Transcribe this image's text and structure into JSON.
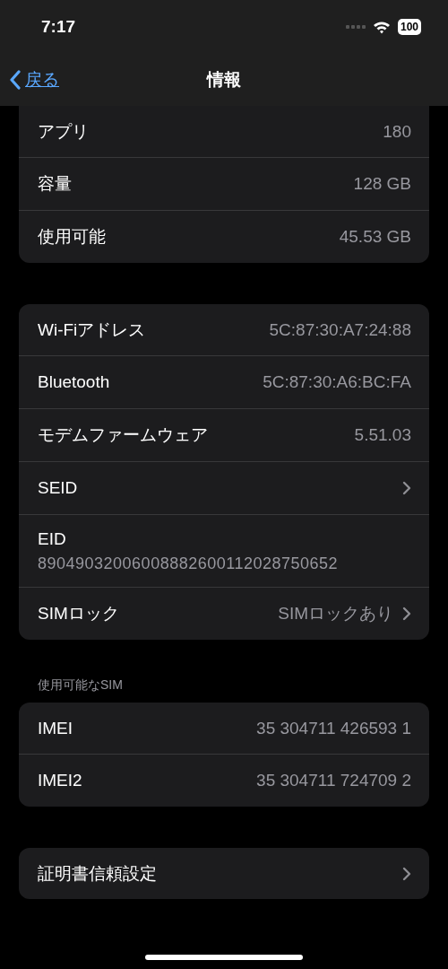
{
  "status_bar": {
    "time": "7:17",
    "battery": "100"
  },
  "nav": {
    "back": "戻る",
    "title": "情報"
  },
  "groups": [
    {
      "cut_top": true,
      "rows": [
        {
          "kind": "value",
          "label": "アプリ",
          "value": "180"
        },
        {
          "kind": "value",
          "label": "容量",
          "value": "128 GB"
        },
        {
          "kind": "value",
          "label": "使用可能",
          "value": "45.53 GB"
        }
      ]
    },
    {
      "rows": [
        {
          "kind": "value",
          "label": "Wi-Fiアドレス",
          "value": "5C:87:30:A7:24:88"
        },
        {
          "kind": "value",
          "label": "Bluetooth",
          "value": "5C:87:30:A6:BC:FA"
        },
        {
          "kind": "value",
          "label": "モデムファームウェア",
          "value": "5.51.03"
        },
        {
          "kind": "link",
          "label": "SEID"
        },
        {
          "kind": "stacked",
          "label": "EID",
          "value": "89049032006008882600112028750652"
        },
        {
          "kind": "link",
          "label": "SIMロック",
          "value": "SIMロックあり"
        }
      ]
    },
    {
      "header": "使用可能なSIM",
      "rows": [
        {
          "kind": "value",
          "label": "IMEI",
          "value": "35 304711 426593 1"
        },
        {
          "kind": "value",
          "label": "IMEI2",
          "value": "35 304711 724709 2"
        }
      ]
    },
    {
      "rows": [
        {
          "kind": "link",
          "label": "証明書信頼設定"
        }
      ]
    }
  ]
}
